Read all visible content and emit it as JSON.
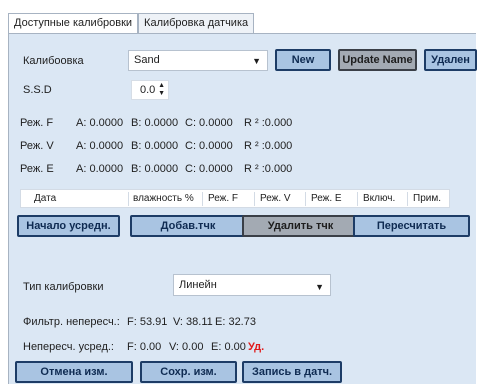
{
  "tabs": [
    "Доступные калибровки",
    "Калибровка датчика"
  ],
  "calibration": {
    "label": "Калибоовка",
    "value": "Sand",
    "new_label": "New",
    "update_label": "Update Name",
    "delete_label": "Удален"
  },
  "ssd": {
    "label": "S.S.D",
    "value": "0.0"
  },
  "modes": [
    {
      "name": "Реж. F",
      "a": "A: 0.0000",
      "b": "B: 0.0000",
      "c": "C: 0.0000",
      "r": "R ² :0.000"
    },
    {
      "name": "Реж. V",
      "a": "A: 0.0000",
      "b": "B: 0.0000",
      "c": "C: 0.0000",
      "r": "R ² :0.000"
    },
    {
      "name": "Реж. E",
      "a": "A: 0.0000",
      "b": "B: 0.0000",
      "c": "C: 0.0000",
      "r": "R ² :0.000"
    }
  ],
  "grid": {
    "columns": [
      "Дата",
      "влажность %",
      "Реж. F",
      "Реж. V",
      "Реж. E",
      "Включ.",
      "Прим."
    ]
  },
  "actions": {
    "averaging_start": "Начало усредн.",
    "add_point": "Добав.тчк",
    "delete_point": "Удалить тчк",
    "recalculate": "Пересчитать"
  },
  "calib_type": {
    "label": "Тип калибровки",
    "value": "Линейн"
  },
  "filtered": {
    "label": "Фильтр. непересч.:",
    "f": "F: 53.91",
    "v": "V: 38.11",
    "e": "E: 32.73"
  },
  "averaged": {
    "label": "Непересч. усред.:",
    "f": "F: 0.00",
    "v": "V: 0.00",
    "e": "E: 0.00",
    "flag": "Уд."
  },
  "footer": {
    "cancel_label": "Отмена изм.",
    "save_label": "Сохр. изм.",
    "write_label": "Запись в датч."
  },
  "colors": {
    "panel": "#dbe7f4",
    "button_blue": "#a9c4e2",
    "button_grey": "#a3aab3",
    "warning": "#e01b1b"
  }
}
